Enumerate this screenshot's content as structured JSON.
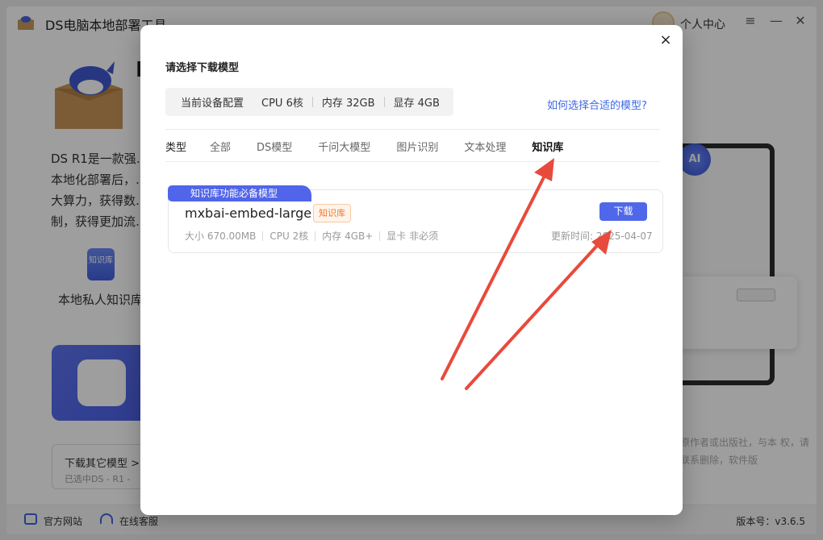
{
  "app": {
    "title": "DS电脑本地部署工具",
    "user_center": "个人中心",
    "hero_title": "D",
    "hero_subtitle": "",
    "description": "DS R1是一款强… 本地化部署后，… 大算力，获得数… 制，获得更加流…",
    "feature_icon_text": "知识库",
    "feature_label": "本地私人知识库",
    "other_model_title": "下载其它模型 >",
    "other_model_sub": "已选中DS - R1 -",
    "faint_text": "原作者或出版社，与本 权，请联系删除，软件版",
    "preview_ai": "AI",
    "footer": {
      "website": "官方网站",
      "support": "在线客服",
      "version": "版本号：v3.6.5"
    },
    "colors": {
      "accent": "#4f68ea",
      "link": "#3e68e6",
      "tag": "#f0782a"
    }
  },
  "modal": {
    "title": "请选择下载模型",
    "close_icon": "×",
    "config": {
      "label": "当前设备配置",
      "cpu": "CPU 6核",
      "memory": "内存 32GB",
      "gpu": "显存 4GB"
    },
    "help_link": "如何选择合适的模型?",
    "type_label": "类型",
    "tabs": [
      {
        "label": "全部",
        "active": false
      },
      {
        "label": "DS模型",
        "active": false
      },
      {
        "label": "千问大模型",
        "active": false
      },
      {
        "label": "图片识别",
        "active": false
      },
      {
        "label": "文本处理",
        "active": false
      },
      {
        "label": "知识库",
        "active": true
      }
    ],
    "model": {
      "ribbon": "知识库功能必备模型",
      "name": "mxbai-embed-large",
      "tag": "知识库",
      "size": "大小 670.00MB",
      "cpu": "CPU 2核",
      "memory": "内存 4GB+",
      "gpu": "显卡 非必须",
      "download_label": "下载",
      "update_time": "更新时间: 2025-04-07"
    }
  }
}
